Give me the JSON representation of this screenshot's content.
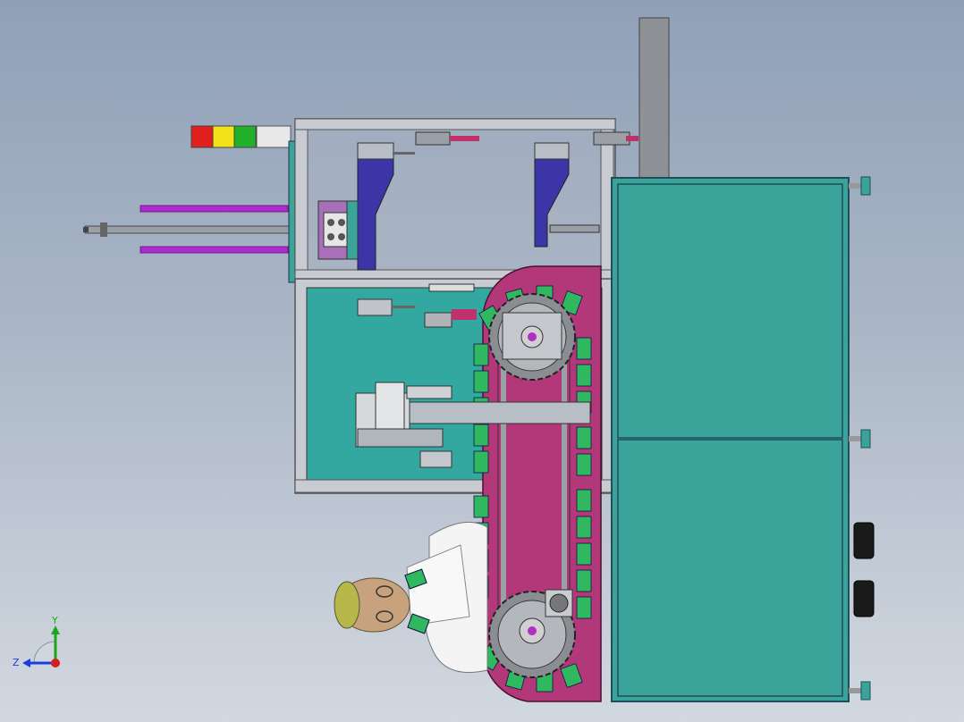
{
  "viewport": {
    "background_top": "#8fa0b8",
    "background_bottom": "#d2d8e0"
  },
  "colors": {
    "cabinet": "#3aa39a",
    "cabinet_edge": "#1f4e5a",
    "frame": "#c8ccd2",
    "magenta_conveyor": "#b3387a",
    "green_carrier": "#2fb860",
    "blue_hopper": "#3b35a8",
    "cylinder_purple": "#b02ad0",
    "panel_teal": "#33a8a0",
    "sprocket_gray": "#8a8e92"
  },
  "signal_tower": {
    "lights": [
      "red",
      "yellow",
      "green",
      "white"
    ],
    "colors": [
      "#e0201c",
      "#f2e21a",
      "#22b02a",
      "#f0f0f0"
    ]
  },
  "triad": {
    "y_label": "Y",
    "z_label": "Z",
    "y_color": "#1aa81a",
    "z_color": "#1c3cdc",
    "origin_color": "#d81c1c"
  }
}
